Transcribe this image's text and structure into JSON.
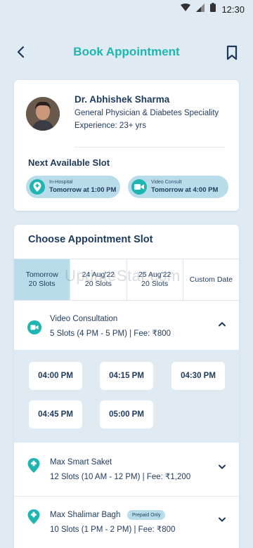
{
  "status": {
    "time": "12:30"
  },
  "header": {
    "title": "Book Appointment"
  },
  "doctor": {
    "name": "Dr. Abhishek Sharma",
    "specialty": "General Physician & Diabetes Speciality",
    "experience": "Experience: 23+ yrs"
  },
  "next_slot": {
    "title": "Next Available Slot",
    "in_hospital": {
      "label": "In-Hospital",
      "time": "Tomorrow at 1:00 PM"
    },
    "video": {
      "label": "Video Consult",
      "time": "Tomorrow at 4:00 PM"
    }
  },
  "slots": {
    "title": "Choose Appointment Slot",
    "watermark": "UpdateStar.com",
    "date_tabs": [
      {
        "line1": "Tomorrow",
        "line2": "20 Slots"
      },
      {
        "line1": "24 Aug'22",
        "line2": "20 Slots"
      },
      {
        "line1": "25 Aug'22",
        "line2": "20 Slots"
      },
      {
        "line1": "Custom Date",
        "line2": ""
      }
    ],
    "video": {
      "title": "Video Consultation",
      "summary": "5 Slots (4 PM - 5 PM)  |  Fee: ₹800",
      "times": [
        "04:00 PM",
        "04:15 PM",
        "04:30 PM",
        "04:45 PM",
        "05:00 PM"
      ]
    },
    "hospitals": [
      {
        "name": "Max Smart Saket",
        "summary": "12 Slots (10 AM - 12 PM)  |  Fee: ₹1,200",
        "badge": ""
      },
      {
        "name": "Max Shalimar Bagh",
        "summary": "10 Slots (1 PM - 2 PM)  |  Fee: ₹800",
        "badge": "Prepaid Only"
      }
    ]
  },
  "colors": {
    "accent": "#1fb5b0",
    "navy": "#1d3a5c",
    "background": "#dfeaf2",
    "highlight": "#b9dcea"
  }
}
